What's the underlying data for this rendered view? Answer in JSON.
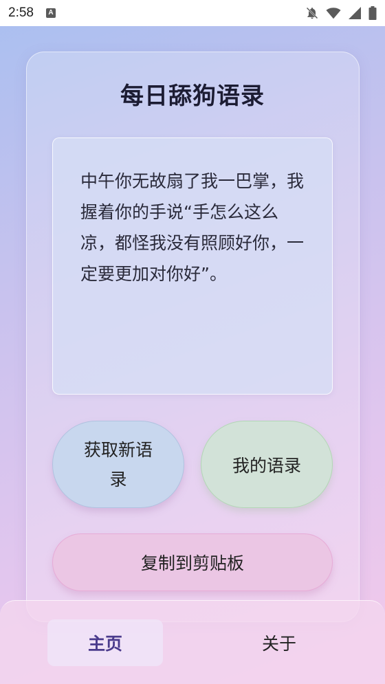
{
  "status_bar": {
    "time": "2:58",
    "app_icon_letter": "A"
  },
  "app": {
    "title": "每日舔狗语录"
  },
  "quote": {
    "text": "中午你无故扇了我一巴掌，我握着你的手说“手怎么这么凉，都怪我没有照顾好你，一定要更加对你好”。"
  },
  "buttons": {
    "get_new_label": "获取新语录",
    "my_quotes_label": "我的语录",
    "copy_label": "复制到剪贴板"
  },
  "nav": {
    "home_label": "主页",
    "about_label": "关于"
  },
  "colors": {
    "accent": "#4a3a8c",
    "new_button": "#c8d7ee",
    "mine_button": "#d2e2d8",
    "copy_button": "#ebc6e4"
  },
  "icons": [
    "notifications-off-icon",
    "wifi-icon",
    "cell-signal-icon",
    "battery-icon"
  ]
}
